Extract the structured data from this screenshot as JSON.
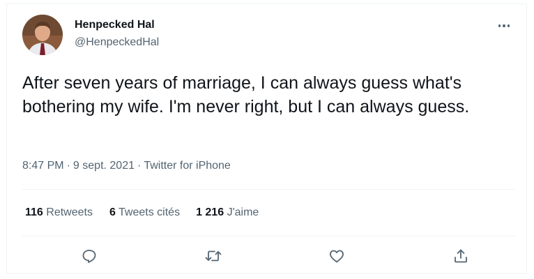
{
  "tweet": {
    "author": {
      "name": "Henpecked Hal",
      "handle": "@HenpeckedHal"
    },
    "text": "After seven years of marriage, I can always guess what's bothering my wife. I'm never right, but I can always guess.",
    "meta": {
      "time": "8:47 PM",
      "separator": "·",
      "date": "9 sept. 2021",
      "source": "Twitter for iPhone"
    },
    "stats": {
      "retweets_count": "116",
      "retweets_label": "Retweets",
      "quotes_count": "6",
      "quotes_label": "Tweets cités",
      "likes_count": "1 216",
      "likes_label": "J'aime"
    },
    "actions": [
      "reply-icon",
      "retweet-icon",
      "like-icon",
      "share-icon"
    ],
    "more_icon": "more-icon"
  },
  "colors": {
    "text_primary": "#0f1419",
    "text_secondary": "#536471",
    "border": "#eff3f4",
    "background": "#ffffff"
  }
}
